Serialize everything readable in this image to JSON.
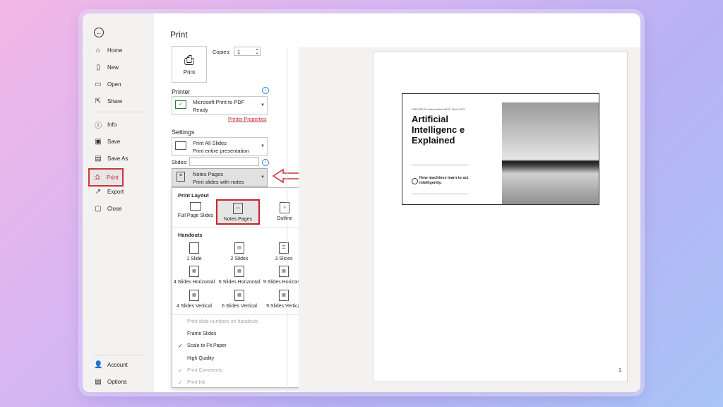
{
  "nav": {
    "items": [
      {
        "label": "Home",
        "icon": "home-icon",
        "glyph": "⌂"
      },
      {
        "label": "New",
        "icon": "new-file-icon",
        "glyph": "▯"
      },
      {
        "label": "Open",
        "icon": "folder-open-icon",
        "glyph": "▭"
      },
      {
        "label": "Share",
        "icon": "share-icon",
        "glyph": "⇱"
      },
      {
        "label": "Info",
        "icon": "info-icon",
        "glyph": "ⓘ"
      },
      {
        "label": "Save",
        "icon": "save-icon",
        "glyph": "▣"
      },
      {
        "label": "Save As",
        "icon": "save-as-icon",
        "glyph": "▤"
      },
      {
        "label": "Print",
        "icon": "print-icon",
        "glyph": "⎙",
        "active": true
      },
      {
        "label": "Export",
        "icon": "export-icon",
        "glyph": "↗"
      },
      {
        "label": "Close",
        "icon": "close-icon",
        "glyph": "▢"
      }
    ],
    "bottom": [
      {
        "label": "Account",
        "icon": "account-icon",
        "glyph": "👤"
      },
      {
        "label": "Options",
        "icon": "options-icon",
        "glyph": "▤"
      }
    ]
  },
  "print": {
    "title": "Print",
    "button_label": "Print",
    "copies_label": "Copies:",
    "copies_value": "1",
    "printer_heading": "Printer",
    "printer_name": "Microsoft Print to PDF",
    "printer_status": "Ready",
    "printer_properties": "Printer Properties",
    "settings_heading": "Settings",
    "range_line1": "Print All Slides",
    "range_line2": "Print entire presentation",
    "slides_label": "Slides:",
    "slides_value": "",
    "layout_line1": "Notes Pages",
    "layout_line2": "Print slides with notes"
  },
  "menu": {
    "print_layout_heading": "Print Layout",
    "layouts": [
      "Full Page Slides",
      "Notes Pages",
      "Outline"
    ],
    "handouts_heading": "Handouts",
    "handouts": [
      "1 Slide",
      "2 Slides",
      "3 Slides",
      "4 Slides Horizontal",
      "6 Slides Horizontal",
      "9 Slides Horizontal",
      "4 Slides Vertical",
      "6 Slides Vertical",
      "9 Slides Vertical"
    ],
    "options": [
      {
        "label": "Print slide numbers on handouts",
        "disabled": true,
        "checked": false
      },
      {
        "label": "Frame Slides",
        "disabled": false,
        "checked": false
      },
      {
        "label": "Scale to Fit Paper",
        "disabled": false,
        "checked": true
      },
      {
        "label": "High Quality",
        "disabled": false,
        "checked": false
      },
      {
        "label": "Print Comments",
        "disabled": true,
        "checked": true
      },
      {
        "label": "Print Ink",
        "disabled": true,
        "checked": true
      }
    ]
  },
  "preview": {
    "slide_meta": "CREATED BY Usama Akbari DATE: March 2025",
    "slide_title": "Artificial Intelligenc e Explained",
    "slide_subtitle": "How machines learn to act intelligently.",
    "page_number": "1"
  },
  "colors": {
    "accent_red": "#c4262e",
    "info_blue": "#2b7cd3"
  }
}
